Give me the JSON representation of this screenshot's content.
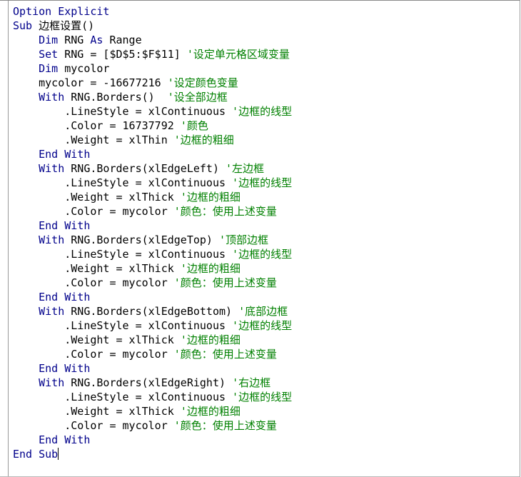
{
  "editor": {
    "lines": [
      [
        {
          "t": "kw",
          "v": "Option Explicit"
        }
      ],
      [
        {
          "t": "kw",
          "v": "Sub "
        },
        {
          "t": "tx",
          "v": "边框设置()"
        }
      ],
      [
        {
          "t": "tx",
          "v": "    "
        },
        {
          "t": "kw",
          "v": "Dim "
        },
        {
          "t": "tx",
          "v": "RNG "
        },
        {
          "t": "kw",
          "v": "As "
        },
        {
          "t": "tx",
          "v": "Range"
        }
      ],
      [
        {
          "t": "tx",
          "v": "    "
        },
        {
          "t": "kw",
          "v": "Set "
        },
        {
          "t": "tx",
          "v": "RNG = [$D$5:$F$11] "
        },
        {
          "t": "cm",
          "v": "'设定单元格区域变量"
        }
      ],
      [
        {
          "t": "tx",
          "v": "    "
        },
        {
          "t": "kw",
          "v": "Dim "
        },
        {
          "t": "tx",
          "v": "mycolor"
        }
      ],
      [
        {
          "t": "tx",
          "v": "    mycolor = -16677216 "
        },
        {
          "t": "cm",
          "v": "'设定颜色变量"
        }
      ],
      [
        {
          "t": "tx",
          "v": "    "
        },
        {
          "t": "kw",
          "v": "With "
        },
        {
          "t": "tx",
          "v": "RNG.Borders()  "
        },
        {
          "t": "cm",
          "v": "'设全部边框"
        }
      ],
      [
        {
          "t": "tx",
          "v": "        .LineStyle = xlContinuous "
        },
        {
          "t": "cm",
          "v": "'边框的线型"
        }
      ],
      [
        {
          "t": "tx",
          "v": "        .Color = 16737792 "
        },
        {
          "t": "cm",
          "v": "'颜色"
        }
      ],
      [
        {
          "t": "tx",
          "v": "        .Weight = xlThin "
        },
        {
          "t": "cm",
          "v": "'边框的粗细"
        }
      ],
      [
        {
          "t": "tx",
          "v": "    "
        },
        {
          "t": "kw",
          "v": "End With"
        }
      ],
      [
        {
          "t": "tx",
          "v": "    "
        },
        {
          "t": "kw",
          "v": "With "
        },
        {
          "t": "tx",
          "v": "RNG.Borders(xlEdgeLeft) "
        },
        {
          "t": "cm",
          "v": "'左边框"
        }
      ],
      [
        {
          "t": "tx",
          "v": "        .LineStyle = xlContinuous "
        },
        {
          "t": "cm",
          "v": "'边框的线型"
        }
      ],
      [
        {
          "t": "tx",
          "v": "        .Weight = xlThick "
        },
        {
          "t": "cm",
          "v": "'边框的粗细"
        }
      ],
      [
        {
          "t": "tx",
          "v": "        .Color = mycolor "
        },
        {
          "t": "cm",
          "v": "'颜色：使用上述变量"
        }
      ],
      [
        {
          "t": "tx",
          "v": "    "
        },
        {
          "t": "kw",
          "v": "End With"
        }
      ],
      [
        {
          "t": "tx",
          "v": "    "
        },
        {
          "t": "kw",
          "v": "With "
        },
        {
          "t": "tx",
          "v": "RNG.Borders(xlEdgeTop) "
        },
        {
          "t": "cm",
          "v": "'顶部边框"
        }
      ],
      [
        {
          "t": "tx",
          "v": "        .LineStyle = xlContinuous "
        },
        {
          "t": "cm",
          "v": "'边框的线型"
        }
      ],
      [
        {
          "t": "tx",
          "v": "        .Weight = xlThick "
        },
        {
          "t": "cm",
          "v": "'边框的粗细"
        }
      ],
      [
        {
          "t": "tx",
          "v": "        .Color = mycolor "
        },
        {
          "t": "cm",
          "v": "'颜色：使用上述变量"
        }
      ],
      [
        {
          "t": "tx",
          "v": "    "
        },
        {
          "t": "kw",
          "v": "End With"
        }
      ],
      [
        {
          "t": "tx",
          "v": "    "
        },
        {
          "t": "kw",
          "v": "With "
        },
        {
          "t": "tx",
          "v": "RNG.Borders(xlEdgeBottom) "
        },
        {
          "t": "cm",
          "v": "'底部边框"
        }
      ],
      [
        {
          "t": "tx",
          "v": "        .LineStyle = xlContinuous "
        },
        {
          "t": "cm",
          "v": "'边框的线型"
        }
      ],
      [
        {
          "t": "tx",
          "v": "        .Weight = xlThick "
        },
        {
          "t": "cm",
          "v": "'边框的粗细"
        }
      ],
      [
        {
          "t": "tx",
          "v": "        .Color = mycolor "
        },
        {
          "t": "cm",
          "v": "'颜色：使用上述变量"
        }
      ],
      [
        {
          "t": "tx",
          "v": "    "
        },
        {
          "t": "kw",
          "v": "End With"
        }
      ],
      [
        {
          "t": "tx",
          "v": "    "
        },
        {
          "t": "kw",
          "v": "With "
        },
        {
          "t": "tx",
          "v": "RNG.Borders(xlEdgeRight) "
        },
        {
          "t": "cm",
          "v": "'右边框"
        }
      ],
      [
        {
          "t": "tx",
          "v": "        .LineStyle = xlContinuous "
        },
        {
          "t": "cm",
          "v": "'边框的线型"
        }
      ],
      [
        {
          "t": "tx",
          "v": "        .Weight = xlThick "
        },
        {
          "t": "cm",
          "v": "'边框的粗细"
        }
      ],
      [
        {
          "t": "tx",
          "v": "        .Color = mycolor "
        },
        {
          "t": "cm",
          "v": "'颜色：使用上述变量"
        }
      ],
      [
        {
          "t": "tx",
          "v": "    "
        },
        {
          "t": "kw",
          "v": "End With"
        }
      ],
      [
        {
          "t": "kw",
          "v": "End Sub"
        }
      ]
    ],
    "caret_line": 31
  },
  "colors": {
    "keyword": "#00008b",
    "comment": "#008000",
    "text": "#000000",
    "background": "#ffffff"
  }
}
